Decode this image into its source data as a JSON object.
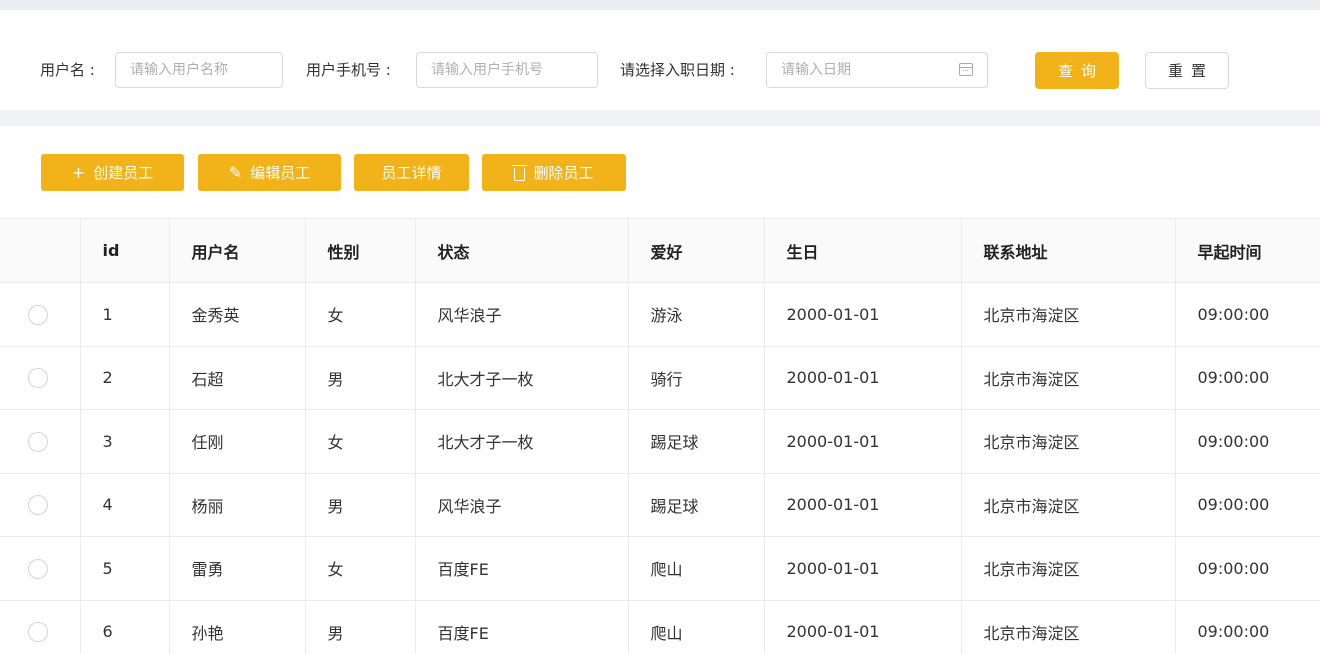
{
  "filters": {
    "username_label": "用户名 :",
    "username_placeholder": "请输入用户名称",
    "phone_label": "用户手机号 :",
    "phone_placeholder": "请输入用户手机号",
    "date_label": "请选择入职日期 :",
    "date_placeholder": "请输入日期",
    "query_label": "查询",
    "reset_label": "重置"
  },
  "actions": {
    "create": "创建员工",
    "edit": "编辑员工",
    "detail": "员工详情",
    "delete": "删除员工"
  },
  "table": {
    "columns": [
      "id",
      "用户名",
      "性别",
      "状态",
      "爱好",
      "生日",
      "联系地址",
      "早起时间"
    ],
    "rows": [
      [
        "1",
        "金秀英",
        "女",
        "风华浪子",
        "游泳",
        "2000-01-01",
        "北京市海淀区",
        "09:00:00"
      ],
      [
        "2",
        "石超",
        "男",
        "北大才子一枚",
        "骑行",
        "2000-01-01",
        "北京市海淀区",
        "09:00:00"
      ],
      [
        "3",
        "任刚",
        "女",
        "北大才子一枚",
        "踢足球",
        "2000-01-01",
        "北京市海淀区",
        "09:00:00"
      ],
      [
        "4",
        "杨丽",
        "男",
        "风华浪子",
        "踢足球",
        "2000-01-01",
        "北京市海淀区",
        "09:00:00"
      ],
      [
        "5",
        "雷勇",
        "女",
        "百度FE",
        "爬山",
        "2000-01-01",
        "北京市海淀区",
        "09:00:00"
      ],
      [
        "6",
        "孙艳",
        "男",
        "百度FE",
        "爬山",
        "2000-01-01",
        "北京市海淀区",
        "09:00:00"
      ]
    ]
  },
  "colors": {
    "accent": "#f1b21a",
    "background": "#f0f2f5"
  }
}
